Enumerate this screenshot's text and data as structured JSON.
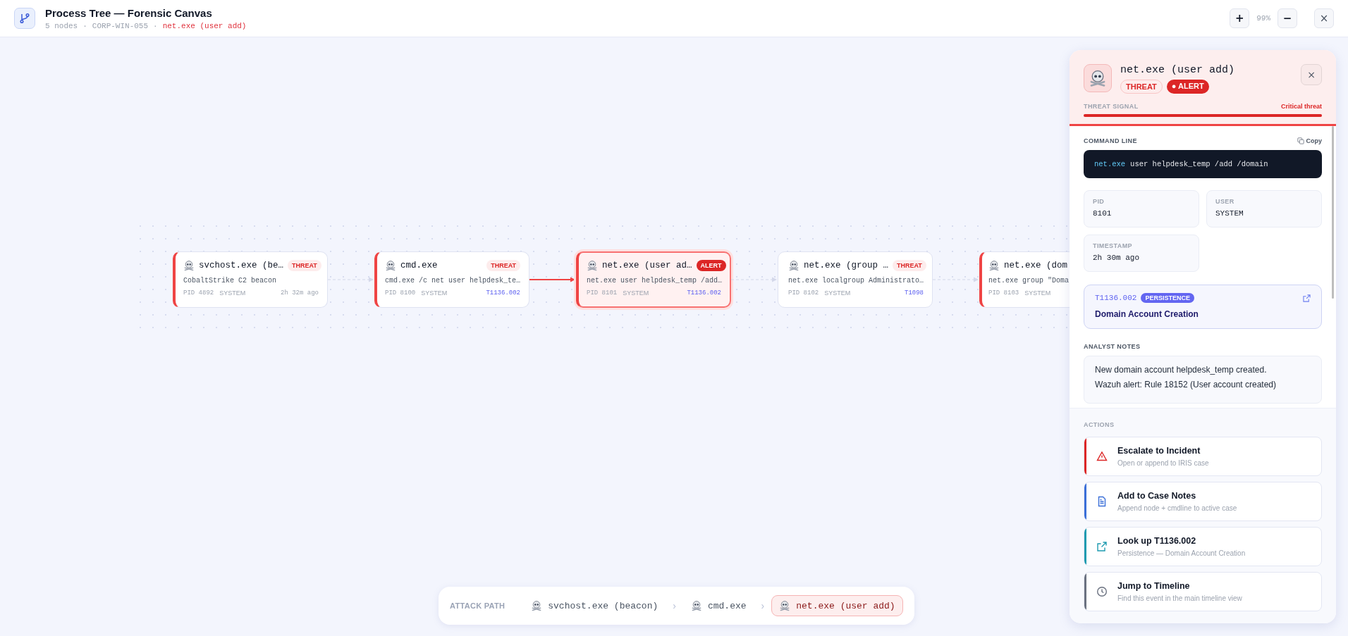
{
  "header": {
    "title": "Process Tree — Forensic Canvas",
    "node_count": "5 nodes",
    "host": "CORP-WIN-055",
    "focus": "net.exe (user add)",
    "zoom_in": "+",
    "zoom": "99%",
    "zoom_out": "−",
    "close": "×",
    "separator": "·"
  },
  "nodes": [
    {
      "name": "svchost.exe (be…",
      "badge": {
        "label": "THREAT",
        "kind": "threat"
      },
      "command": "CobaltStrike C2 beacon",
      "pid": "PID 4892",
      "user": "SYSTEM",
      "meta": {
        "kind": "time",
        "text": "2h 32m ago"
      },
      "flagged": true,
      "selected": false
    },
    {
      "name": "cmd.exe",
      "badge": {
        "label": "THREAT",
        "kind": "threat"
      },
      "command": "cmd.exe /c net user helpdesk_te…",
      "pid": "PID 8100",
      "user": "SYSTEM",
      "meta": {
        "kind": "technique",
        "text": "T1136.002"
      },
      "flagged": true,
      "selected": false
    },
    {
      "name": "net.exe (user ad…",
      "badge": {
        "label": "ALERT",
        "kind": "alert"
      },
      "command": "net.exe user helpdesk_temp /add…",
      "pid": "PID 8101",
      "user": "SYSTEM",
      "meta": {
        "kind": "technique",
        "text": "T1136.002"
      },
      "flagged": true,
      "selected": true
    },
    {
      "name": "net.exe (group …",
      "badge": {
        "label": "THREAT",
        "kind": "threat"
      },
      "command": "net.exe localgroup Administrato…",
      "pid": "PID 8102",
      "user": "SYSTEM",
      "meta": {
        "kind": "technique",
        "text": "T1098"
      },
      "flagged": false,
      "selected": false
    },
    {
      "name": "net.exe (dom",
      "command": "net.exe group \"Doma",
      "pid": "PID 8103",
      "user": "SYSTEM",
      "flagged": true,
      "selected": false
    }
  ],
  "edges": [
    {
      "kind": "dashed"
    },
    {
      "kind": "active"
    },
    {
      "kind": "dashed"
    },
    {
      "kind": "dashed"
    }
  ],
  "panel": {
    "title": "net.exe (user add)",
    "badges": [
      {
        "label": "THREAT",
        "kind": "threat"
      },
      {
        "label": "● ALERT",
        "kind": "alert"
      }
    ],
    "close": "×",
    "signal": {
      "label": "THREAT SIGNAL",
      "reading": "Critical threat",
      "level": 1
    },
    "command_label": "COMMAND LINE",
    "copy": "Copy",
    "command_exe": "net.exe",
    "command_args": "user helpdesk_temp /add /domain",
    "fields": [
      {
        "label": "PID",
        "value": "8101"
      },
      {
        "label": "USER",
        "value": "SYSTEM"
      },
      {
        "label": "TIMESTAMP",
        "value": "2h 30m ago"
      }
    ],
    "technique": {
      "id": "T1136.002",
      "tactic": "PERSISTENCE",
      "name": "Domain Account Creation"
    },
    "notes_label": "ANALYST NOTES",
    "notes": [
      "New domain account helpdesk_temp created.",
      "Wazuh alert: Rule 18152 (User account created)"
    ],
    "actions_label": "ACTIONS",
    "actions": [
      {
        "kind": "escalate",
        "title": "Escalate to Incident",
        "subtitle": "Open or append to IRIS case",
        "color": "#dc2626"
      },
      {
        "kind": "notes",
        "title": "Add to Case Notes",
        "subtitle": "Append node + cmdline to active case",
        "color": "#3b6fd8"
      },
      {
        "kind": "lookup",
        "title": "Look up T1136.002",
        "subtitle": "Persistence — Domain Account Creation",
        "color": "#1e9bb0"
      },
      {
        "kind": "timeline",
        "title": "Jump to Timeline",
        "subtitle": "Find this event in the main timeline view",
        "color": "#6b7280"
      }
    ]
  },
  "attack_path": {
    "label": "ATTACK PATH",
    "steps": [
      {
        "name": "svchost.exe (beacon)",
        "selected": false
      },
      {
        "name": "cmd.exe",
        "selected": false
      },
      {
        "name": "net.exe (user add)",
        "selected": true
      }
    ],
    "separator": "›"
  }
}
